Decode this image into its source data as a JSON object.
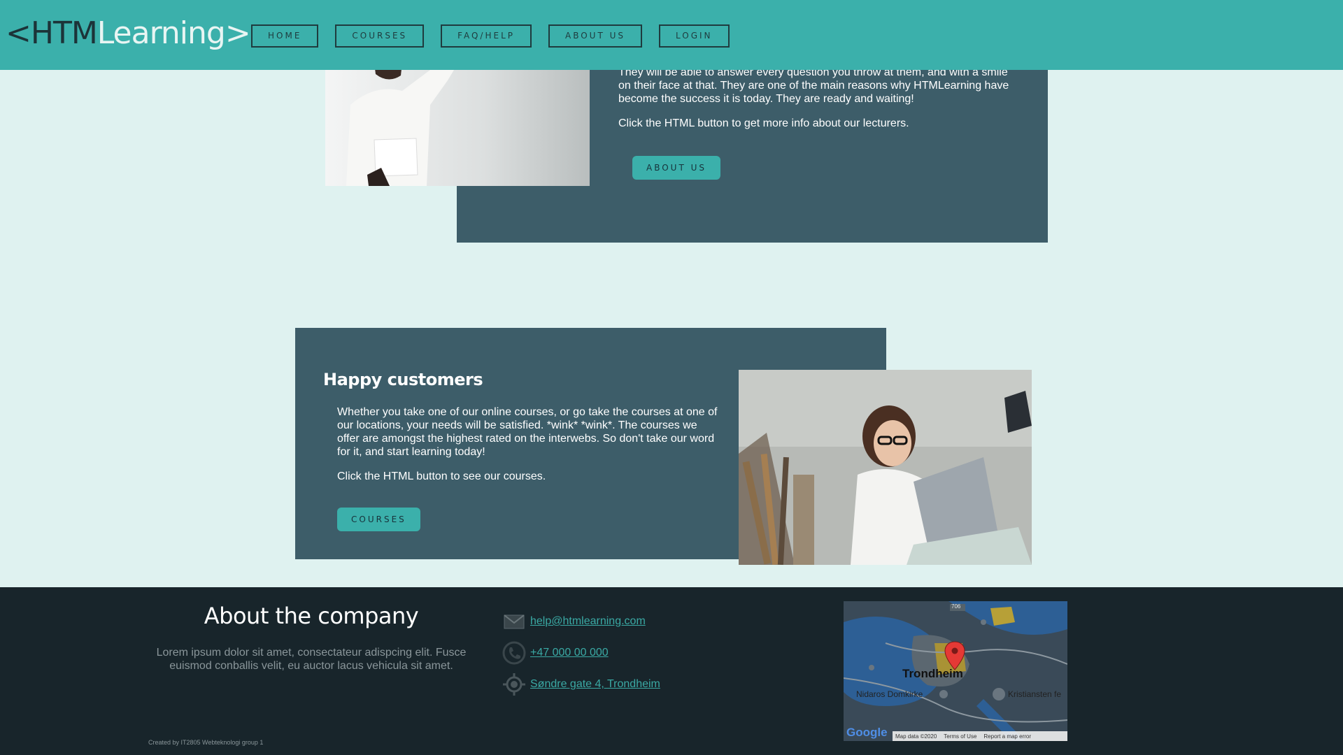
{
  "header": {
    "logo": {
      "part1": "<HTM",
      "part2": "Learning>"
    },
    "nav": [
      {
        "label": "HOME"
      },
      {
        "label": "COURSES"
      },
      {
        "label": "FAQ/HELP"
      },
      {
        "label": "ABOUT US"
      },
      {
        "label": "LOGIN"
      }
    ]
  },
  "lecturers": {
    "paragraph1": "They will be able to answer every question you throw at them, and with a smile on their face at that. They are one of the main reasons why HTMLearning have become the success it is today. They are ready and waiting!",
    "paragraph2": "Click the HTML button to get more info about our lecturers.",
    "button": "ABOUT US"
  },
  "customers": {
    "title": "Happy customers",
    "paragraph1": "Whether you take one of our online courses, or go take the courses at one of our locations, your needs will be satisfied. *wink* *wink*. The courses we offer are amongst the highest rated on the interwebs. So don't take our word for it, and start learning today!",
    "paragraph2": "Click the HTML button to see our courses.",
    "button": "COURSES"
  },
  "footer": {
    "title": "About the company",
    "text": "Lorem ipsum dolor sit amet, consectateur adispcing elit. Fusce euismod conballis velit, eu auctor lacus vehicula sit amet.",
    "email": "help@htmlearning.com",
    "phone": "+47 000 00 000",
    "address": "Søndre gate 4, Trondheim",
    "credit": "Created by IT2805 Webteknologi group 1",
    "map": {
      "city": "Trondheim",
      "label_domkirke": "Nidaros Domkirke",
      "label_kristiansten": "Kristiansten fe",
      "map_data": "Map data ©2020",
      "terms": "Terms of Use",
      "report": "Report a map error",
      "road_number": "706",
      "google": "Google"
    }
  },
  "colors": {
    "accent": "#3bb0ab",
    "panel": "#3d5d69",
    "background": "#dff2f0",
    "footer": "#18252b"
  }
}
